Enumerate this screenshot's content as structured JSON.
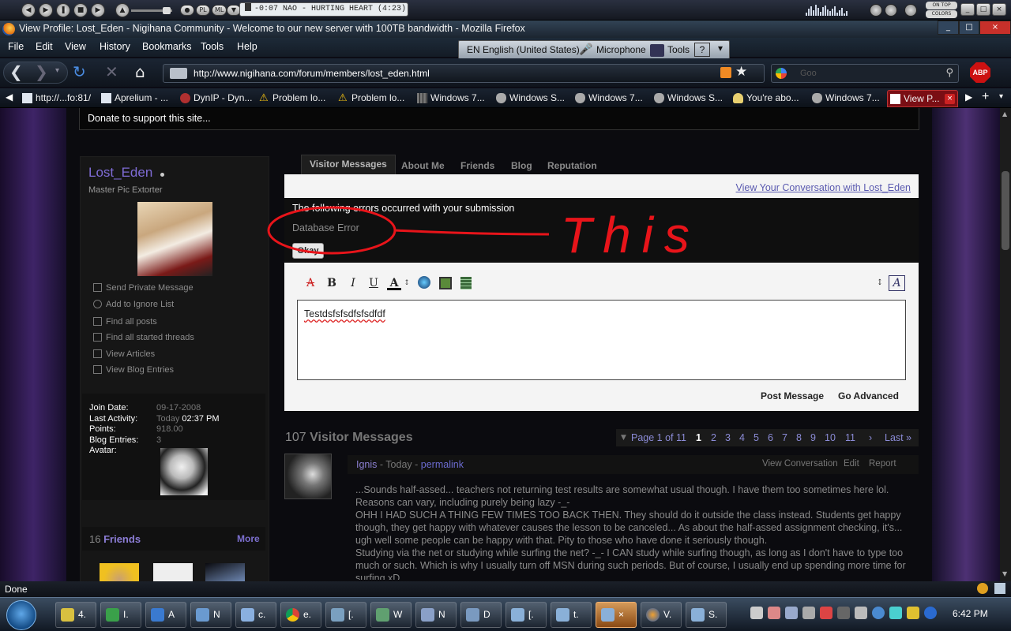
{
  "media": {
    "now_playing": "-0:07  NAO - HURTING HEART (4:23)",
    "pl_label": "PL",
    "ml_label": "ML",
    "on_top": "ON TOP",
    "colors": "COLORS"
  },
  "window": {
    "title": "View Profile: Lost_Eden - Nigihana Community - Welcome to our new server with 100TB bandwidth - Mozilla Firefox"
  },
  "menu": [
    "File",
    "Edit",
    "View",
    "History",
    "Bookmarks",
    "Tools",
    "Help"
  ],
  "langbar": {
    "lang": "EN  English (United States)",
    "microphone": "Microphone",
    "tools": "Tools"
  },
  "nav": {
    "url": "http://www.nigihana.com/forum/members/lost_eden.html",
    "search_placeholder": "Goo",
    "abp": "ABP"
  },
  "tabs": [
    {
      "label": "http://...fo:81/",
      "color": "#dfe6f0"
    },
    {
      "label": "Aprelium - ...",
      "color": "#dfe6f0"
    },
    {
      "label": "DynIP - Dyn...",
      "color": "#b03030"
    },
    {
      "label": "Problem lo...",
      "color": "#f2c012"
    },
    {
      "label": "Problem lo...",
      "color": "#f2c012"
    },
    {
      "label": "Windows 7...",
      "color": "#666"
    },
    {
      "label": "Windows S...",
      "color": "#999"
    },
    {
      "label": "Windows 7...",
      "color": "#999"
    },
    {
      "label": "Windows S...",
      "color": "#999"
    },
    {
      "label": "You're abo...",
      "color": "#e8d070"
    },
    {
      "label": "Windows 7...",
      "color": "#999"
    },
    {
      "label": "View P...",
      "color": "#fff",
      "active": true
    }
  ],
  "page": {
    "donate": "Donate to support this site...",
    "username": "Lost_Eden",
    "user_title": "Master Pic Extorter",
    "actions": [
      "Send Private Message",
      "Add to Ignore List",
      "Find all posts",
      "Find all started threads",
      "View Articles",
      "View Blog Entries"
    ],
    "stats": {
      "join_label": "Join Date:",
      "join_value": "09-17-2008",
      "activity_label": "Last Activity:",
      "activity_day": "Today",
      "activity_time": "02:37 PM",
      "points_label": "Points:",
      "points_value": "918.00",
      "blog_label": "Blog Entries:",
      "blog_value": "3",
      "avatar_label": "Avatar:"
    },
    "friends": {
      "count": "16",
      "label": "Friends",
      "more": "More"
    },
    "profile_tabs": [
      "Visitor Messages",
      "About Me",
      "Friends",
      "Blog",
      "Reputation"
    ],
    "conversation_link": "View Your Conversation with Lost_Eden",
    "error_title": "The following errors occurred with your submission",
    "error_item": "Database Error",
    "okay": "Okay",
    "editor_text": "Testdsfsfsdfsfsdfdf",
    "post_message": "Post Message",
    "go_advanced": "Go Advanced",
    "annotation": "This",
    "vm_count": "107",
    "vm_label": "Visitor Messages",
    "pager": {
      "page_of": "Page 1 of 11",
      "pages": [
        "1",
        "2",
        "3",
        "4",
        "5",
        "6",
        "7",
        "8",
        "9",
        "10",
        "11"
      ],
      "next": "›",
      "last": "Last »"
    },
    "message": {
      "author": "Ignis",
      "time": " - Today - ",
      "permalink": "permalink",
      "actions": [
        "View Conversation",
        "Edit",
        "Report"
      ],
      "body": [
        "...Sounds half-assed... teachers not returning test results are somewhat usual though. I have them too sometimes here lol. Reasons can vary, including purely being lazy -_-",
        "OHH I HAD SUCH A THING FEW TIMES TOO BACK THEN. They should do it outside the class instead. Students get happy though, they get happy with whatever causes the lesson to be canceled... As about the half-assed assignment checking, it's... ugh well some people can be happy with that. Pity to those who have done it seriously though.",
        "Studying via the net or studying while surfing the net? -_- I CAN study while surfing though, as long as I don't have to type too much or such. Which is why I usually turn off MSN during such periods. But of course, I usually end up spending more time for surfing xD"
      ]
    }
  },
  "status": "Done",
  "taskbar": {
    "tasks": [
      "4.",
      "I.",
      "A",
      "N",
      "c.",
      "e.",
      "[.",
      "W",
      "N",
      "D",
      "[.",
      "t.",
      "×",
      "V.",
      "S."
    ],
    "clock": "6:42 PM"
  }
}
